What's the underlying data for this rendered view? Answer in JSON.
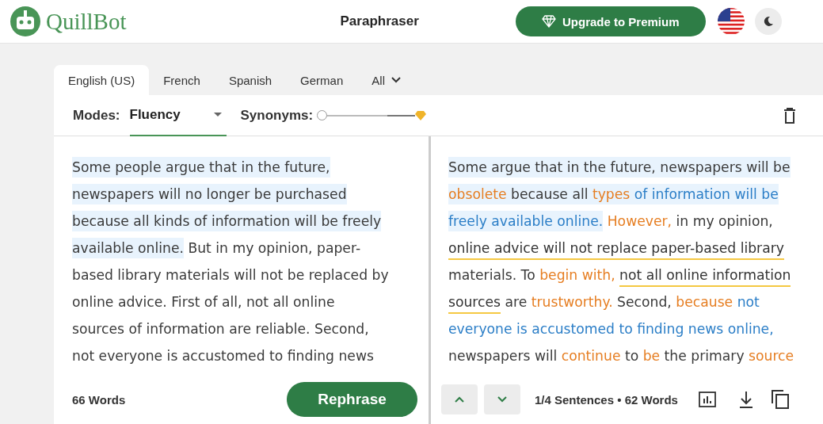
{
  "header": {
    "brand": "QuillBot",
    "title": "Paraphraser",
    "upgrade_button": "Upgrade to Premium"
  },
  "tabs": [
    {
      "label": "English (US)",
      "selected": true
    },
    {
      "label": "French",
      "selected": false
    },
    {
      "label": "Spanish",
      "selected": false
    },
    {
      "label": "German",
      "selected": false
    },
    {
      "label": "All",
      "selected": false,
      "kind": "dropdown"
    }
  ],
  "toolbar": {
    "modes_label": "Modes:",
    "mode": "Fluency",
    "synonyms_label": "Synonyms:",
    "synonyms_slider": {
      "level": 0
    }
  },
  "input": {
    "lines": [
      [
        {
          "text": "Some people argue that in the future,",
          "kind": "plain",
          "highlighted": true
        }
      ],
      [
        {
          "text": "newspapers will no longer be purchased ",
          "kind": "plain",
          "highlighted": true
        }
      ],
      [
        {
          "text": "because all kinds of information will be freely",
          "kind": "plain",
          "highlighted": true
        }
      ],
      [
        {
          "text": "available online.",
          "kind": "plain",
          "highlighted": true
        },
        {
          "text": " But in my opinion, paper-",
          "kind": "plain",
          "highlighted": false
        }
      ],
      [
        {
          "text": "based library materials will not be replaced by",
          "kind": "plain",
          "highlighted": false
        }
      ],
      [
        {
          "text": "online advice. First of all, not all online",
          "kind": "plain",
          "highlighted": false
        }
      ],
      [
        {
          "text": "sources of information are reliable. Second,",
          "kind": "plain",
          "highlighted": false
        }
      ],
      [
        {
          "text": "not everyone is accustomed to finding news",
          "kind": "plain",
          "highlighted": false
        }
      ]
    ],
    "word_count": "66 Words",
    "rephrase_button": "Rephrase"
  },
  "output": {
    "lines": [
      [
        {
          "text": "Some argue that in the future, newspapers will be",
          "kind": "plain",
          "highlighted": true
        }
      ],
      [
        {
          "text": "obsolete",
          "kind": "changed",
          "highlighted": true
        },
        {
          "text": " because all ",
          "kind": "plain",
          "highlighted": true
        },
        {
          "text": "types",
          "kind": "changed",
          "highlighted": true
        },
        {
          "text": " of information will be",
          "kind": "structural",
          "highlighted": true
        }
      ],
      [
        {
          "text": "freely available online.",
          "kind": "structural",
          "highlighted": true
        },
        {
          "text": " However,",
          "kind": "changed",
          "highlighted": false
        },
        {
          "text": " in my opinion,",
          "kind": "plain",
          "highlighted": false
        }
      ],
      [
        {
          "text": "online advice will not replace paper-based library",
          "kind": "flagged",
          "highlighted": false
        }
      ],
      [
        {
          "text": "materials. To ",
          "kind": "plain",
          "highlighted": false
        },
        {
          "text": "begin with, ",
          "kind": "changed",
          "highlighted": false
        },
        {
          "text": "not all online information",
          "kind": "flagged",
          "highlighted": false
        }
      ],
      [
        {
          "text": "sources",
          "kind": "flagged",
          "highlighted": false
        },
        {
          "text": " are ",
          "kind": "plain",
          "highlighted": false
        },
        {
          "text": "trustworthy.",
          "kind": "changed",
          "highlighted": false
        },
        {
          "text": " Second, ",
          "kind": "plain",
          "highlighted": false
        },
        {
          "text": "because",
          "kind": "changed",
          "highlighted": false
        },
        {
          "text": " not",
          "kind": "structural",
          "highlighted": false
        }
      ],
      [
        {
          "text": "everyone is accustomed to finding news online,",
          "kind": "structural",
          "highlighted": false
        }
      ],
      [
        {
          "text": "newspapers will ",
          "kind": "plain",
          "highlighted": false
        },
        {
          "text": "continue",
          "kind": "changed",
          "highlighted": false
        },
        {
          "text": " to ",
          "kind": "plain",
          "highlighted": false
        },
        {
          "text": "be",
          "kind": "changed",
          "highlighted": false
        },
        {
          "text": " the primary ",
          "kind": "plain",
          "highlighted": false
        },
        {
          "text": "source",
          "kind": "changed",
          "highlighted": false
        }
      ]
    ],
    "stats": "1/4 Sentences • 62 Words"
  }
}
